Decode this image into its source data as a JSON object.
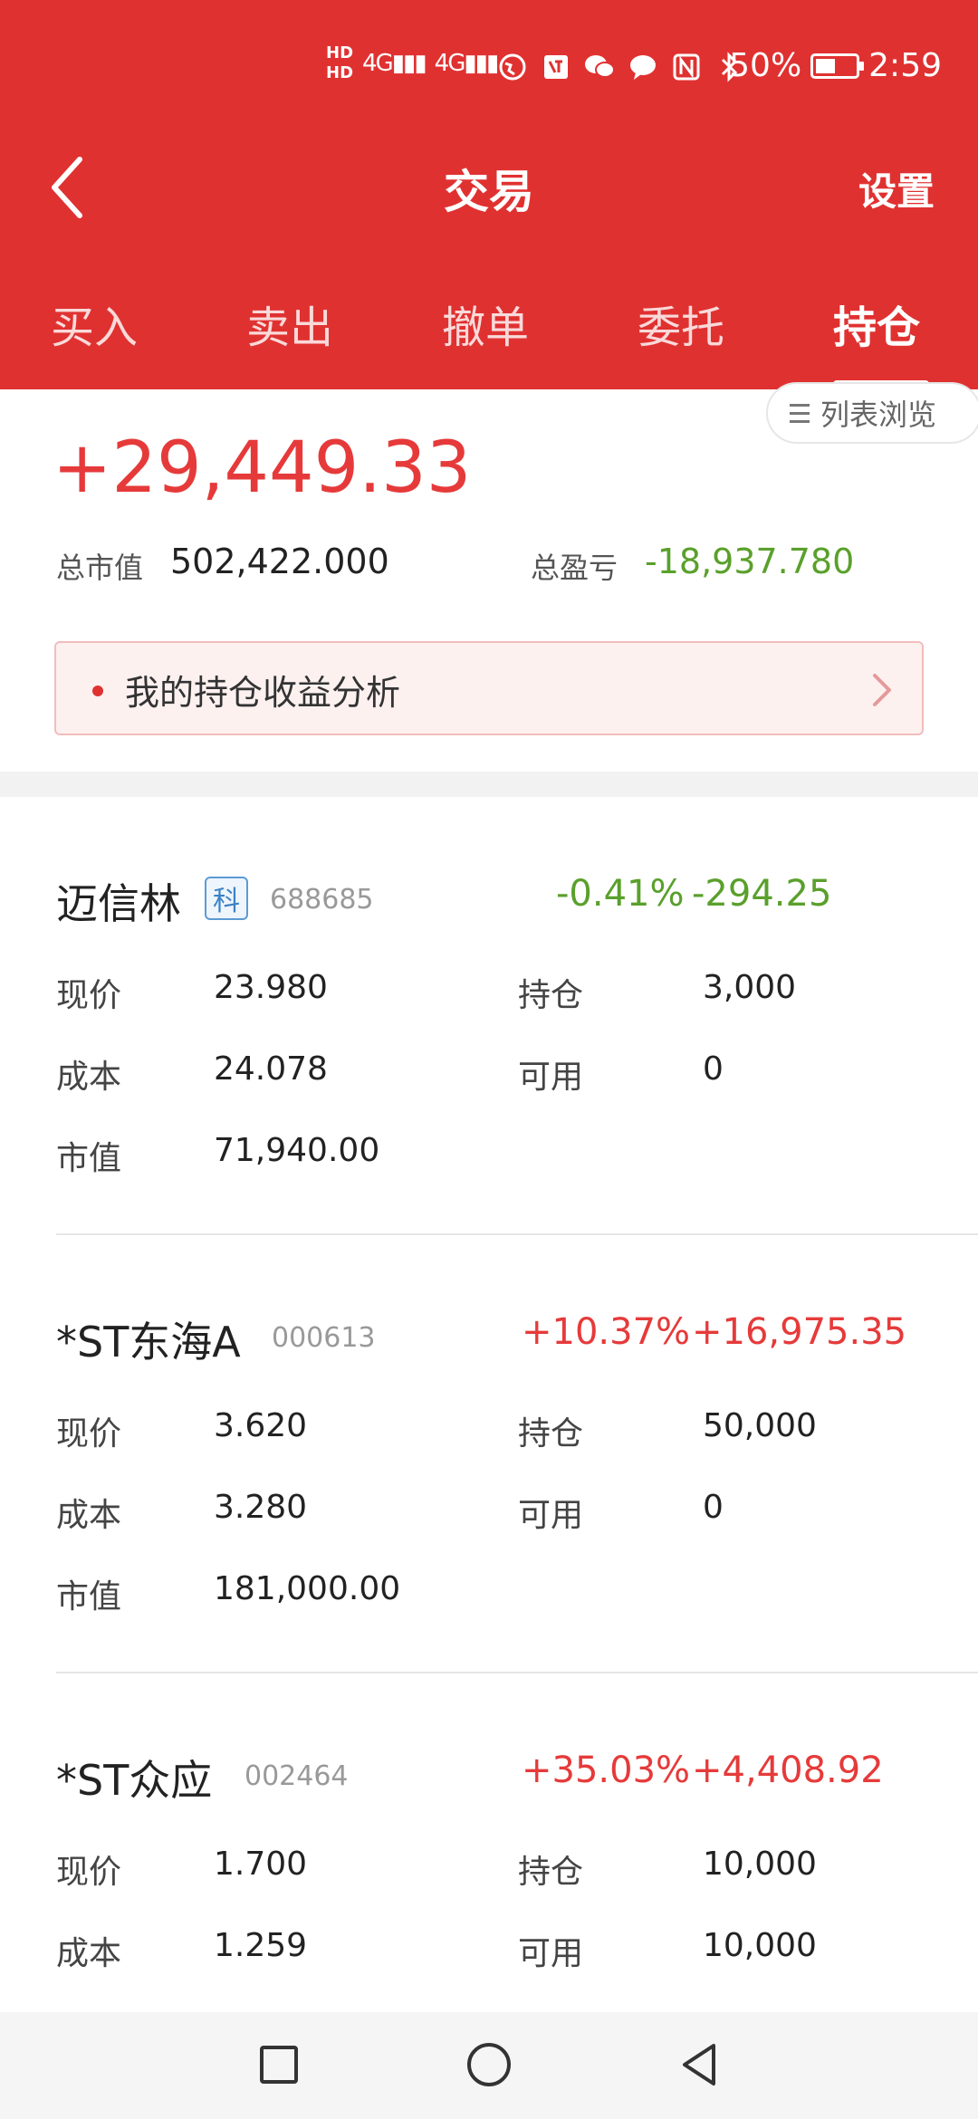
{
  "status_bar": {
    "hd1": "HD",
    "hd2": "HD",
    "signal1": "4G",
    "signal2": "4G",
    "battery_percent": "50%",
    "battery_level": 0.5,
    "time": "2:59",
    "icons": [
      "globe-icon",
      "app-badge-icon",
      "wechat-icon",
      "message-icon",
      "nfc-icon",
      "bluetooth-icon"
    ]
  },
  "nav": {
    "title": "交易",
    "settings_label": "设置"
  },
  "tabs": [
    {
      "label": "买入",
      "active": false
    },
    {
      "label": "卖出",
      "active": false
    },
    {
      "label": "撤单",
      "active": false
    },
    {
      "label": "委托",
      "active": false
    },
    {
      "label": "持仓",
      "active": true
    }
  ],
  "summary": {
    "list_toggle_label": "列表浏览",
    "profit": "+29,449.33",
    "market_value_label": "总市值",
    "market_value": "502,422.000",
    "total_pl_label": "总盈亏",
    "total_pl": "-18,937.780",
    "analysis_label": "我的持仓收益分析"
  },
  "holdings": [
    {
      "name": "迈信林",
      "tag": "科",
      "code": "688685",
      "pct": "-0.41%",
      "amount": "-294.25",
      "direction": "down",
      "price_label": "现价",
      "price": "23.980",
      "position_label": "持仓",
      "position": "3,000",
      "cost_label": "成本",
      "cost": "24.078",
      "available_label": "可用",
      "available": "0",
      "mv_label": "市值",
      "mv": "71,940.00"
    },
    {
      "name": "*ST东海A",
      "tag": "",
      "code": "000613",
      "pct": "+10.37%",
      "amount": "+16,975.35",
      "direction": "up",
      "price_label": "现价",
      "price": "3.620",
      "position_label": "持仓",
      "position": "50,000",
      "cost_label": "成本",
      "cost": "3.280",
      "available_label": "可用",
      "available": "0",
      "mv_label": "市值",
      "mv": "181,000.00"
    },
    {
      "name": "*ST众应",
      "tag": "",
      "code": "002464",
      "pct": "+35.03%",
      "amount": "+4,408.92",
      "direction": "up",
      "price_label": "现价",
      "price": "1.700",
      "position_label": "持仓",
      "position": "10,000",
      "cost_label": "成本",
      "cost": "1.259",
      "available_label": "可用",
      "available": "10,000",
      "mv_label": "市值",
      "mv": ""
    }
  ],
  "colors": {
    "brand": "#e03131",
    "up": "#e63a3a",
    "down": "#5aa02c"
  }
}
